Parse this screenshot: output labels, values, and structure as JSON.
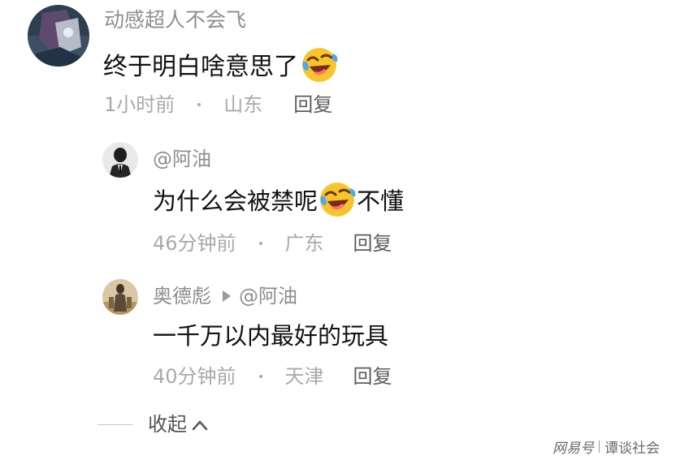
{
  "comment": {
    "username": "动感超人不会飞",
    "text": "终于明白啥意思了",
    "emoji": "laughing-crying-emoji",
    "time": "1小时前",
    "location": "山东",
    "reply_label": "回复"
  },
  "replies": [
    {
      "username": "@阿油",
      "text_before": "为什么会被禁呢",
      "emoji": "laughing-crying-emoji",
      "text_after": "不懂",
      "time": "46分钟前",
      "location": "广东",
      "reply_label": "回复"
    },
    {
      "username": "奥德彪",
      "reply_to": "@阿油",
      "text": "一千万以内最好的玩具",
      "time": "40分钟前",
      "location": "天津",
      "reply_label": "回复"
    }
  ],
  "collapse_label": "收起",
  "watermark": {
    "brand": "网易号",
    "channel": "谭谈社会"
  },
  "colors": {
    "username": "#8e8e8e",
    "meta": "#a9a9a9",
    "reply": "#5c5c5c",
    "emoji_face": "#f7c52b"
  }
}
